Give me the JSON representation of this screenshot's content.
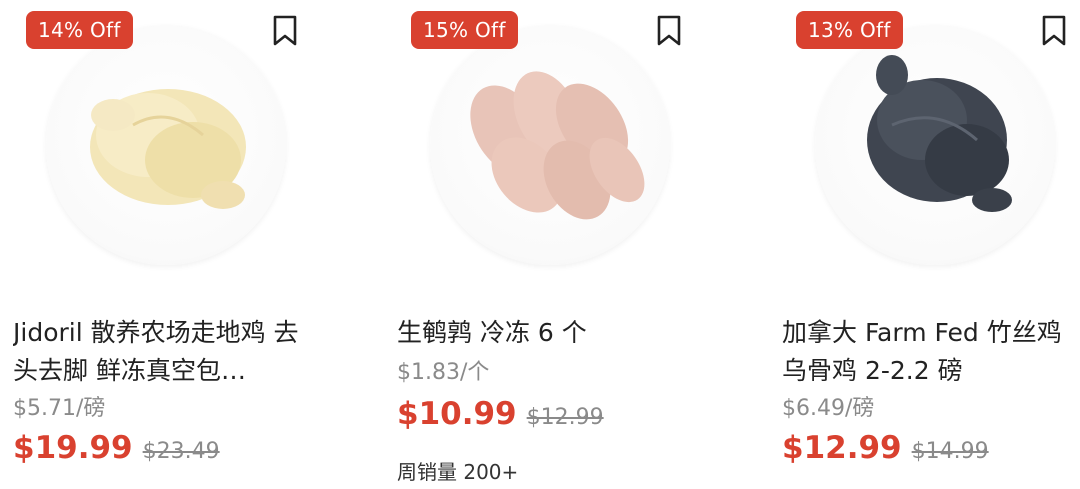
{
  "products": [
    {
      "discount": "14% Off",
      "title": "Jidoril 散养农场走地鸡 去头去脚 鲜冻真空包…",
      "unit_price": "$5.71/磅",
      "price": "$19.99",
      "original_price": "$23.49"
    },
    {
      "discount": "15% Off",
      "title": "生鹌鹑 冷冻 6 个",
      "unit_price": "$1.83/个",
      "price": "$10.99",
      "original_price": "$12.99",
      "sales": "周销量 200+"
    },
    {
      "discount": "13% Off",
      "title": "加拿大 Farm Fed 竹丝鸡 乌骨鸡 2-2.2 磅",
      "unit_price": "$6.49/磅",
      "price": "$12.99",
      "original_price": "$14.99"
    }
  ],
  "colors": {
    "accent": "#d9412f",
    "muted_text": "#8a8a8a"
  },
  "icons": {
    "bookmark": "bookmark-icon"
  }
}
